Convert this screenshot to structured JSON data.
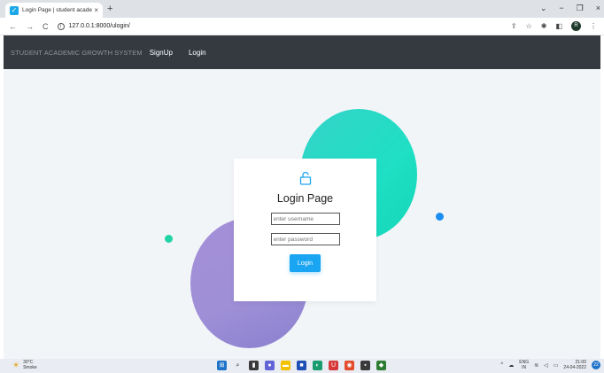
{
  "browser": {
    "tab_title": "Login Page | student academic g",
    "tab_close": "×",
    "new_tab": "+",
    "url": "127.0.0.1:8000/ulogin/",
    "back": "←",
    "forward": "→",
    "reload": "C",
    "window_minimize": "⌄",
    "window_maximize": "−",
    "window_restore": "❐",
    "window_close": "×",
    "profile_initial": "R"
  },
  "navbar": {
    "brand": "STUDENT ACADEMIC GROWTH SYSTEM",
    "signup": "SignUp",
    "login": "Login"
  },
  "login_card": {
    "title": "Login Page",
    "username_placeholder": "enter username",
    "password_placeholder": "enter password",
    "button": "Login"
  },
  "taskbar": {
    "temperature": "30°C",
    "weather": "Smoke",
    "language": "ENG",
    "region": "IN",
    "time": "21:00",
    "date": "24-04-2022",
    "notification_count": "22"
  },
  "colors": {
    "navbar": "#343a40",
    "accent": "#1aa5f2",
    "teal_circle": "#1fdfc4",
    "purple_circle": "#9e8fd7"
  }
}
